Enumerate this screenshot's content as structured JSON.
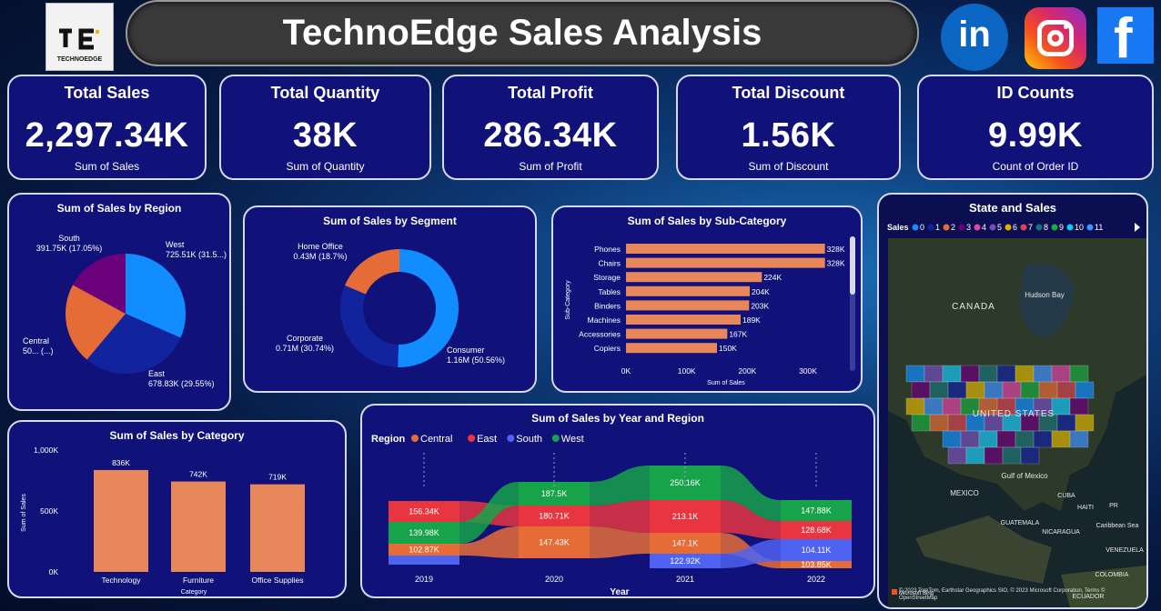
{
  "header": {
    "title": "TechnoEdge Sales Analysis",
    "logo_text": "TECHNOEDGE"
  },
  "kpis": [
    {
      "title": "Total Sales",
      "value": "2,297.34K",
      "sub": "Sum of Sales"
    },
    {
      "title": "Total Quantity",
      "value": "38K",
      "sub": "Sum of Quantity"
    },
    {
      "title": "Total Profit",
      "value": "286.34K",
      "sub": "Sum of Profit"
    },
    {
      "title": "Total Discount",
      "value": "1.56K",
      "sub": "Sum of Discount"
    },
    {
      "title": "ID Counts",
      "value": "9.99K",
      "sub": "Count of Order ID"
    }
  ],
  "social": [
    "linkedin-icon",
    "instagram-icon",
    "facebook-icon"
  ],
  "chart_data": [
    {
      "id": "region",
      "type": "pie",
      "title": "Sum of Sales by Region",
      "slices": [
        {
          "name": "West",
          "value": 725.51,
          "label": "West",
          "detail": "725.51K (31.5...)",
          "color": "#118dff"
        },
        {
          "name": "East",
          "value": 678.83,
          "label": "East",
          "detail": "678.83K (29.55%)",
          "color": "#12239e"
        },
        {
          "name": "Central",
          "value": 501.24,
          "label": "Central",
          "detail": "50... (...)",
          "color": "#e66c37"
        },
        {
          "name": "South",
          "value": 391.75,
          "label": "South",
          "detail": "391.75K (17.05%)",
          "color": "#6b007b"
        }
      ]
    },
    {
      "id": "segment",
      "type": "pie",
      "title": "Sum of Sales by Segment",
      "slices": [
        {
          "name": "Consumer",
          "value": 1.16,
          "label": "Consumer",
          "detail": "1.16M (50.56%)",
          "color": "#118dff"
        },
        {
          "name": "Corporate",
          "value": 0.71,
          "label": "Corporate",
          "detail": "0.71M (30.74%)",
          "color": "#12239e"
        },
        {
          "name": "Home Office",
          "value": 0.43,
          "label": "Home Office",
          "detail": "0.43M (18.7%)",
          "color": "#e66c37"
        }
      ]
    },
    {
      "id": "subcat",
      "type": "bar",
      "title": "Sum of Sales by Sub-Category",
      "categories": [
        "Phones",
        "Chairs",
        "Storage",
        "Tables",
        "Binders",
        "Machines",
        "Accessories",
        "Copiers"
      ],
      "values": [
        328,
        328,
        224,
        204,
        203,
        189,
        167,
        150
      ],
      "value_labels": [
        "328K",
        "328K",
        "224K",
        "204K",
        "203K",
        "189K",
        "167K",
        "150K"
      ],
      "xticks": [
        "0K",
        "100K",
        "200K",
        "300K"
      ],
      "xlabel": "Sum of Sales",
      "ylabel": "Sub-Category",
      "xlim": [
        0,
        330
      ],
      "color": "#e8875a"
    },
    {
      "id": "category",
      "type": "bar",
      "title": "Sum of Sales by Category",
      "categories": [
        "Technology",
        "Furniture",
        "Office Supplies"
      ],
      "values": [
        836,
        742,
        719
      ],
      "value_labels": [
        "836K",
        "742K",
        "719K"
      ],
      "yticks": [
        "0K",
        "500K",
        "1,000K"
      ],
      "xlabel": "Category",
      "ylabel": "Sum of Sales",
      "ylim": [
        0,
        1000
      ],
      "color": "#e8875a"
    },
    {
      "id": "ribbon",
      "type": "area",
      "title": "Sum of Sales by Year and Region",
      "legend_title": "Region",
      "x": [
        "2019",
        "2020",
        "2021",
        "2022"
      ],
      "xlabel": "Year",
      "series": [
        {
          "name": "Central",
          "color": "#e66c37",
          "labels": [
            "102.87K",
            "147.43K",
            "147.1K",
            "103.85K"
          ]
        },
        {
          "name": "East",
          "color": "#e8353f",
          "labels": [
            "156.34K",
            "180.71K",
            "213.1K",
            "128.68K"
          ]
        },
        {
          "name": "South",
          "color": "#4e63f1",
          "labels": [
            "",
            "",
            "122.92K",
            "104.11K"
          ]
        },
        {
          "name": "West",
          "color": "#16a34a",
          "labels": [
            "139.98K",
            "187.5K",
            "250.16K",
            "147.88K"
          ]
        }
      ]
    },
    {
      "id": "map",
      "type": "map",
      "title": "State and Sales",
      "legend_title": "Sales",
      "legend": [
        "0",
        "1",
        "2",
        "3",
        "4",
        "5",
        "6",
        "7",
        "8",
        "9",
        "10",
        "11"
      ],
      "legend_colors": [
        "#118dff",
        "#12239e",
        "#e66c37",
        "#6b007b",
        "#e044a7",
        "#744ec2",
        "#d9b300",
        "#d64550",
        "#197278",
        "#1aab40",
        "#15c6f4",
        "#4092ff"
      ],
      "places": [
        "CANADA",
        "Hudson Bay",
        "UNITED STATES",
        "Gulf of Mexico",
        "MEXICO",
        "CUBA",
        "HAITI",
        "PR",
        "GUATEMALA",
        "NICARAGUA",
        "Caribbean Sea",
        "VENEZUELA",
        "COLOMBIA",
        "ECUADOR"
      ],
      "attribution": "© 2023 TomTom, Earthstar Geographics SIO, © 2023 Microsoft Corporation, Terms © OpenStreetMap",
      "brand": "Microsoft Bing"
    }
  ]
}
